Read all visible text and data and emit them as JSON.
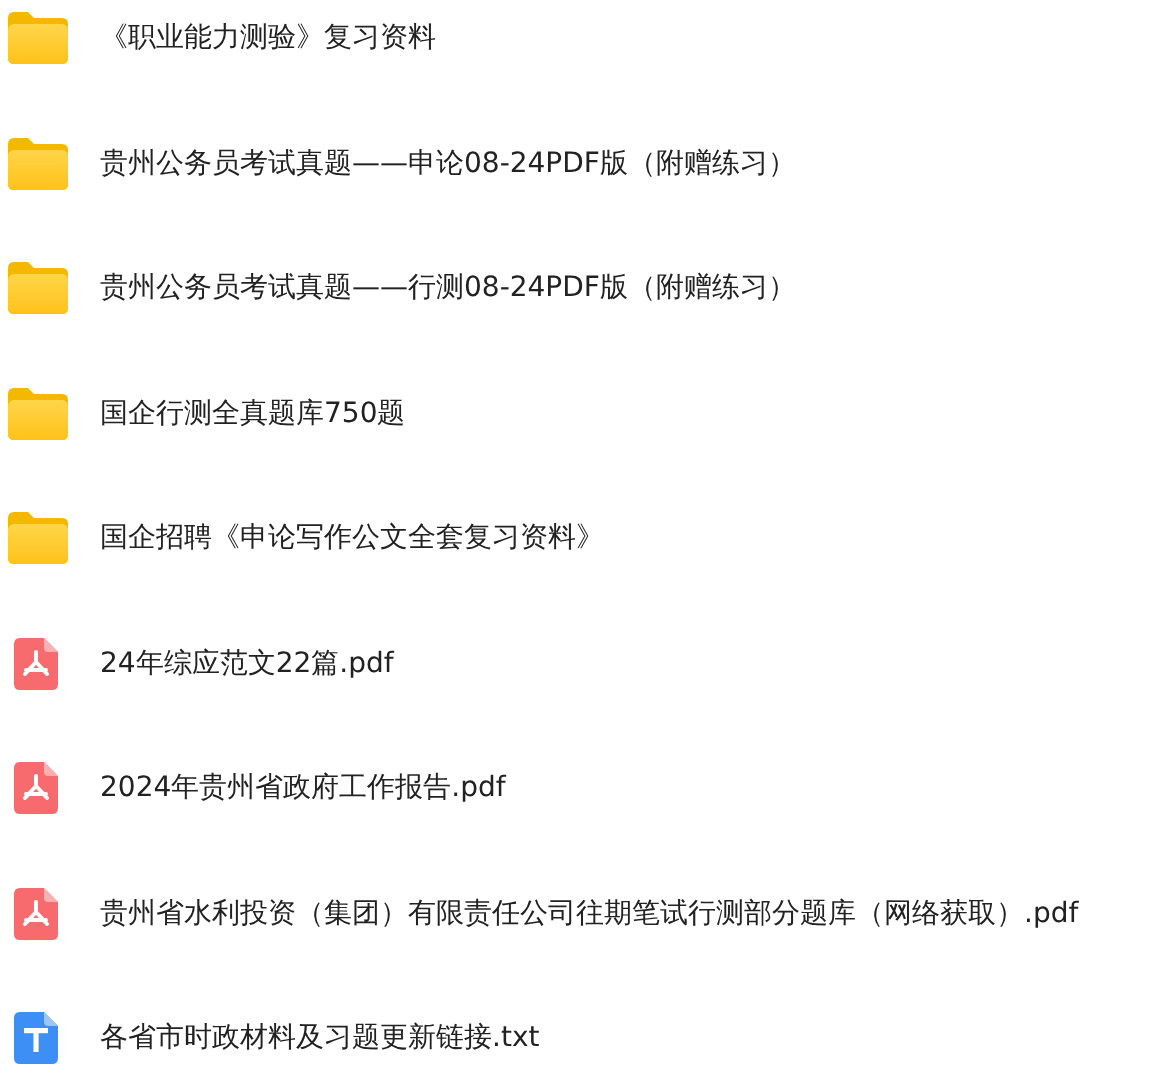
{
  "files": [
    {
      "kind": "folder",
      "name": "《职业能力测验》复习资料"
    },
    {
      "kind": "folder",
      "name": "贵州公务员考试真题——申论08-24PDF版（附赠练习）"
    },
    {
      "kind": "folder",
      "name": "贵州公务员考试真题——行测08-24PDF版（附赠练习）"
    },
    {
      "kind": "folder",
      "name": "国企行测全真题库750题"
    },
    {
      "kind": "folder",
      "name": "国企招聘《申论写作公文全套复习资料》"
    },
    {
      "kind": "pdf",
      "name": "24年综应范文22篇.pdf"
    },
    {
      "kind": "pdf",
      "name": "2024年贵州省政府工作报告.pdf"
    },
    {
      "kind": "pdf",
      "name": "贵州省水利投资（集团）有限责任公司往期笔试行测部分题库（网络获取）.pdf"
    },
    {
      "kind": "txt",
      "name": "各省市时政材料及习题更新链接.txt"
    }
  ]
}
